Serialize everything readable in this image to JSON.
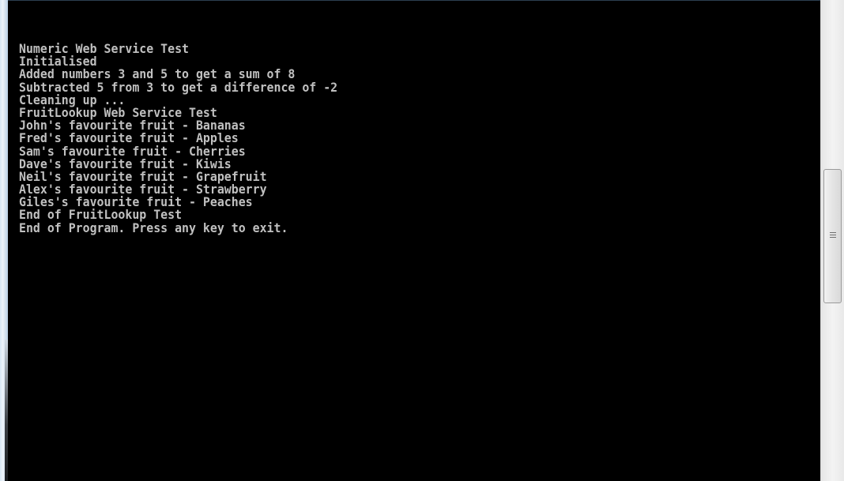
{
  "console": {
    "lines": [
      "Numeric Web Service Test",
      "Initialised",
      "Added numbers 3 and 5 to get a sum of 8",
      "Subtracted 5 from 3 to get a difference of -2",
      "Cleaning up ...",
      "FruitLookup Web Service Test",
      "John's favourite fruit - Bananas",
      "Fred's favourite fruit - Apples",
      "Sam's favourite fruit - Cherries",
      "Dave's favourite fruit - Kiwis",
      "Neil's favourite fruit - Grapefruit",
      "Alex's favourite fruit - Strawberry",
      "Giles's favourite fruit - Peaches",
      "End of FruitLookup Test",
      "End of Program. Press any key to exit."
    ],
    "background_color": "#000000",
    "text_color": "#c0c0c0"
  },
  "scrollbar": {
    "grip_icon": "grip-lines-icon"
  }
}
